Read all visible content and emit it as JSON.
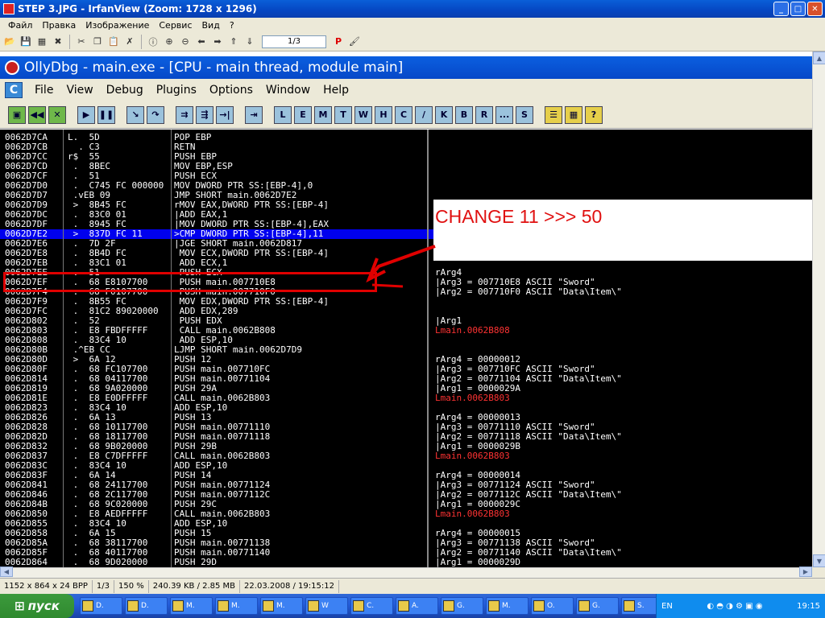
{
  "window": {
    "title": "STEP 3.JPG - IrfanView (Zoom: 1728 x 1296)"
  },
  "menu": [
    "Файл",
    "Правка",
    "Изображение",
    "Сервис",
    "Вид",
    "?"
  ],
  "toolbar": {
    "page_value": "1/3",
    "icons": [
      "open-icon",
      "save-icon",
      "grid-icon",
      "close-icon",
      "cut-icon",
      "copy-icon",
      "paste-icon",
      "delete-icon",
      "info-icon",
      "zoom-in-icon",
      "zoom-out-icon",
      "back-icon",
      "forward-icon",
      "first-icon",
      "last-icon",
      "page-input",
      "print-icon",
      "paint-icon"
    ]
  },
  "olly": {
    "title": "OllyDbg - main.exe - [CPU - main thread, module main]",
    "menu": [
      "File",
      "View",
      "Debug",
      "Plugins",
      "Options",
      "Window",
      "Help"
    ],
    "tool_letters": [
      "L",
      "E",
      "M",
      "T",
      "W",
      "H",
      "C",
      "/",
      "K",
      "B",
      "R",
      "...",
      "S"
    ],
    "note": "CHANGE 11 >>> 50",
    "rows": [
      {
        "addr": "0062D7CA",
        "hex": "L.  5D",
        "dis": "POP EBP"
      },
      {
        "addr": "0062D7CB",
        "hex": "  . C3",
        "dis": "RETN"
      },
      {
        "addr": "0062D7CC",
        "hex": "r$  55",
        "dis": "PUSH EBP"
      },
      {
        "addr": "0062D7CD",
        "hex": " .  8BEC",
        "dis": "MOV EBP,ESP"
      },
      {
        "addr": "0062D7CF",
        "hex": " .  51",
        "dis": "PUSH ECX"
      },
      {
        "addr": "0062D7D0",
        "hex": " .  C745 FC 000000",
        "dis": "MOV DWORD PTR SS:[EBP-4],0"
      },
      {
        "addr": "0062D7D7",
        "hex": " .vEB 09",
        "dis": "JMP SHORT main.0062D7E2"
      },
      {
        "addr": "0062D7D9",
        "hex": " >  8B45 FC",
        "dis": "rMOV EAX,DWORD PTR SS:[EBP-4]"
      },
      {
        "addr": "0062D7DC",
        "hex": " .  83C0 01",
        "dis": "|ADD EAX,1"
      },
      {
        "addr": "0062D7DF",
        "hex": " .  8945 FC",
        "dis": "|MOV DWORD PTR SS:[EBP-4],EAX"
      },
      {
        "addr": "0062D7E2",
        "hex": " >  837D FC 11",
        "dis": ">CMP DWORD PTR SS:[EBP-4],11"
      },
      {
        "addr": "0062D7E6",
        "hex": " .  7D 2F",
        "dis": "|JGE SHORT main.0062D817"
      },
      {
        "addr": "0062D7E8",
        "hex": " .  8B4D FC",
        "dis": " MOV ECX,DWORD PTR SS:[EBP-4]"
      },
      {
        "addr": "0062D7EB",
        "hex": " .  83C1 01",
        "dis": " ADD ECX,1"
      },
      {
        "addr": "0062D7EE",
        "hex": " .  51",
        "dis": " PUSH ECX"
      },
      {
        "addr": "0062D7EF",
        "hex": " .  68 E8107700",
        "dis": " PUSH main.007710E8"
      },
      {
        "addr": "0062D7F4",
        "hex": " .  68 F0107700",
        "dis": " PUSH main.007710F0"
      },
      {
        "addr": "0062D7F9",
        "hex": " .  8B55 FC",
        "dis": " MOV EDX,DWORD PTR SS:[EBP-4]"
      },
      {
        "addr": "0062D7FC",
        "hex": " .  81C2 89020000",
        "dis": " ADD EDX,289"
      },
      {
        "addr": "0062D802",
        "hex": " .  52",
        "dis": " PUSH EDX"
      },
      {
        "addr": "0062D803",
        "hex": " .  E8 FBDFFFFF",
        "dis": " CALL main.0062B808"
      },
      {
        "addr": "0062D808",
        "hex": " .  83C4 10",
        "dis": " ADD ESP,10"
      },
      {
        "addr": "0062D80B",
        "hex": " .^EB CC",
        "dis": "LJMP SHORT main.0062D7D9"
      },
      {
        "addr": "0062D80D",
        "hex": " >  6A 12",
        "dis": "PUSH 12"
      },
      {
        "addr": "0062D80F",
        "hex": " .  68 FC107700",
        "dis": "PUSH main.007710FC"
      },
      {
        "addr": "0062D814",
        "hex": " .  68 04117700",
        "dis": "PUSH main.00771104"
      },
      {
        "addr": "0062D819",
        "hex": " .  68 9A020000",
        "dis": "PUSH 29A"
      },
      {
        "addr": "0062D81E",
        "hex": " .  E8 E0DFFFFF",
        "dis": "CALL main.0062B803"
      },
      {
        "addr": "0062D823",
        "hex": " .  83C4 10",
        "dis": "ADD ESP,10"
      },
      {
        "addr": "0062D826",
        "hex": " .  6A 13",
        "dis": "PUSH 13"
      },
      {
        "addr": "0062D828",
        "hex": " .  68 10117700",
        "dis": "PUSH main.00771110"
      },
      {
        "addr": "0062D82D",
        "hex": " .  68 18117700",
        "dis": "PUSH main.00771118"
      },
      {
        "addr": "0062D832",
        "hex": " .  68 9B020000",
        "dis": "PUSH 29B"
      },
      {
        "addr": "0062D837",
        "hex": " .  E8 C7DFFFFF",
        "dis": "CALL main.0062B803"
      },
      {
        "addr": "0062D83C",
        "hex": " .  83C4 10",
        "dis": "ADD ESP,10"
      },
      {
        "addr": "0062D83F",
        "hex": " .  6A 14",
        "dis": "PUSH 14"
      },
      {
        "addr": "0062D841",
        "hex": " .  68 24117700",
        "dis": "PUSH main.00771124"
      },
      {
        "addr": "0062D846",
        "hex": " .  68 2C117700",
        "dis": "PUSH main.0077112C"
      },
      {
        "addr": "0062D84B",
        "hex": " .  68 9C020000",
        "dis": "PUSH 29C"
      },
      {
        "addr": "0062D850",
        "hex": " .  E8 AEDFFFFF",
        "dis": "CALL main.0062B803"
      },
      {
        "addr": "0062D855",
        "hex": " .  83C4 10",
        "dis": "ADD ESP,10"
      },
      {
        "addr": "0062D858",
        "hex": " .  6A 15",
        "dis": "PUSH 15"
      },
      {
        "addr": "0062D85A",
        "hex": " .  68 38117700",
        "dis": "PUSH main.00771138"
      },
      {
        "addr": "0062D85F",
        "hex": " .  68 40117700",
        "dis": "PUSH main.00771140"
      },
      {
        "addr": "0062D864",
        "hex": " .  68 9D020000",
        "dis": "PUSH 29D"
      }
    ],
    "comments": [
      {
        "row": 14,
        "text": "rArg4",
        "red": false
      },
      {
        "row": 15,
        "text": "|Arg3 = 007710E8 ASCII \"Sword\"",
        "red": false
      },
      {
        "row": 16,
        "text": "|Arg2 = 007710F0 ASCII \"Data\\Item\\\"",
        "red": false
      },
      {
        "row": 19,
        "text": "|Arg1",
        "red": false
      },
      {
        "row": 20,
        "text": "Lmain.0062B808",
        "red": true
      },
      {
        "row": 23,
        "text": "rArg4 = 00000012",
        "red": false
      },
      {
        "row": 24,
        "text": "|Arg3 = 007710FC ASCII \"Sword\"",
        "red": false
      },
      {
        "row": 25,
        "text": "|Arg2 = 00771104 ASCII \"Data\\Item\\\"",
        "red": false
      },
      {
        "row": 26,
        "text": "|Arg1 = 0000029A",
        "red": false
      },
      {
        "row": 27,
        "text": "Lmain.0062B803",
        "red": true
      },
      {
        "row": 29,
        "text": "rArg4 = 00000013",
        "red": false
      },
      {
        "row": 30,
        "text": "|Arg3 = 00771110 ASCII \"Sword\"",
        "red": false
      },
      {
        "row": 31,
        "text": "|Arg2 = 00771118 ASCII \"Data\\Item\\\"",
        "red": false
      },
      {
        "row": 32,
        "text": "|Arg1 = 0000029B",
        "red": false
      },
      {
        "row": 33,
        "text": "Lmain.0062B803",
        "red": true
      },
      {
        "row": 35,
        "text": "rArg4 = 00000014",
        "red": false
      },
      {
        "row": 36,
        "text": "|Arg3 = 00771124 ASCII \"Sword\"",
        "red": false
      },
      {
        "row": 37,
        "text": "|Arg2 = 0077112C ASCII \"Data\\Item\\\"",
        "red": false
      },
      {
        "row": 38,
        "text": "|Arg1 = 0000029C",
        "red": false
      },
      {
        "row": 39,
        "text": "Lmain.0062B803",
        "red": true
      },
      {
        "row": 41,
        "text": "rArg4 = 00000015",
        "red": false
      },
      {
        "row": 42,
        "text": "|Arg3 = 00771138 ASCII \"Sword\"",
        "red": false
      },
      {
        "row": 43,
        "text": "|Arg2 = 00771140 ASCII \"Data\\Item\\\"",
        "red": false
      },
      {
        "row": 44,
        "text": "|Arg1 = 0000029D",
        "red": false
      }
    ],
    "highlight_row": 10
  },
  "status": [
    "1152 x 864 x 24 BPP",
    "1/3",
    "150 %",
    "240.39 KB / 2.85 MB",
    "22.03.2008 / 19:15:12"
  ],
  "taskbar": {
    "start": "пуск",
    "buttons": [
      "D.",
      "D.",
      "M.",
      "M.",
      "M.",
      "W",
      "C.",
      "A.",
      "G.",
      "M.",
      "O.",
      "G.",
      "S.",
      "S."
    ],
    "active_index": 13,
    "lang": "EN",
    "clock": "19:15"
  },
  "colors": {
    "highlight": "#0000ee",
    "annotation": "#e00000"
  }
}
